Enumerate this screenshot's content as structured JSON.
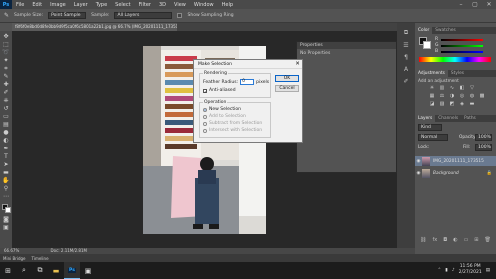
{
  "menubar": {
    "logo": "Ps",
    "items": [
      "File",
      "Edit",
      "Image",
      "Layer",
      "Type",
      "Select",
      "Filter",
      "3D",
      "View",
      "Window",
      "Help"
    ]
  },
  "window_controls": {
    "minimize": "–",
    "maximize": "▢",
    "close": "✕"
  },
  "options_bar": {
    "sample_size_label": "Sample Size:",
    "sample_size_value": "Point Sample",
    "sample_label": "Sample:",
    "sample_value": "All Layers",
    "show_ring_label": "Show Sampling Ring"
  },
  "document_tab": {
    "title": "f8f6f0e8bd0d8fe0bb9d9f5ca0f6c5801a22b1.jpg @ 66.7% (IMG_20201111_173515, RGB/8) *"
  },
  "properties_panel": {
    "title": "Properties",
    "body": "No Properties"
  },
  "dialog": {
    "title": "Make Selection",
    "close": "✕",
    "rendering_label": "Rendering",
    "feather_label": "Feather Radius:",
    "feather_value": "0",
    "feather_unit": "pixels",
    "antialiased_label": "Anti-aliased",
    "antialiased_checked": true,
    "operation_label": "Operation",
    "operations": [
      {
        "label": "New Selection",
        "selected": true,
        "enabled": true
      },
      {
        "label": "Add to Selection",
        "selected": false,
        "enabled": false
      },
      {
        "label": "Subtract from Selection",
        "selected": false,
        "enabled": false
      },
      {
        "label": "Intersect with Selection",
        "selected": false,
        "enabled": false
      }
    ],
    "ok_label": "OK",
    "cancel_label": "Cancel"
  },
  "color_panel": {
    "tabs": [
      "Color",
      "Swatches"
    ],
    "channels": [
      "R",
      "G",
      "B"
    ]
  },
  "adjustments_panel": {
    "tabs": [
      "Adjustments",
      "Styles"
    ],
    "subtitle": "Add an adjustment"
  },
  "layers_panel": {
    "tabs": [
      "Layers",
      "Channels",
      "Paths"
    ],
    "kind_label": "Kind",
    "mode_label": "Normal",
    "opacity_label": "Opacity:",
    "opacity_value": "100%",
    "lock_label": "Lock:",
    "fill_label": "Fill:",
    "fill_value": "100%",
    "layers": [
      {
        "name": "IMG_20201111_173515",
        "selected": true
      },
      {
        "name": "Background",
        "selected": false
      }
    ]
  },
  "status_bar": {
    "zoom": "66.67%",
    "doc": "Doc: 2.11M/2.81M"
  },
  "bridge_bar": {
    "tabs": [
      "Mini Bridge",
      "Timeline"
    ]
  },
  "taskbar": {
    "search_icon": "⌕",
    "time": "11:56 PM",
    "date": "2/27/2021",
    "colors": {
      "taskbar": "#1c1c1c",
      "ps_blue": "#31a8ff"
    }
  }
}
